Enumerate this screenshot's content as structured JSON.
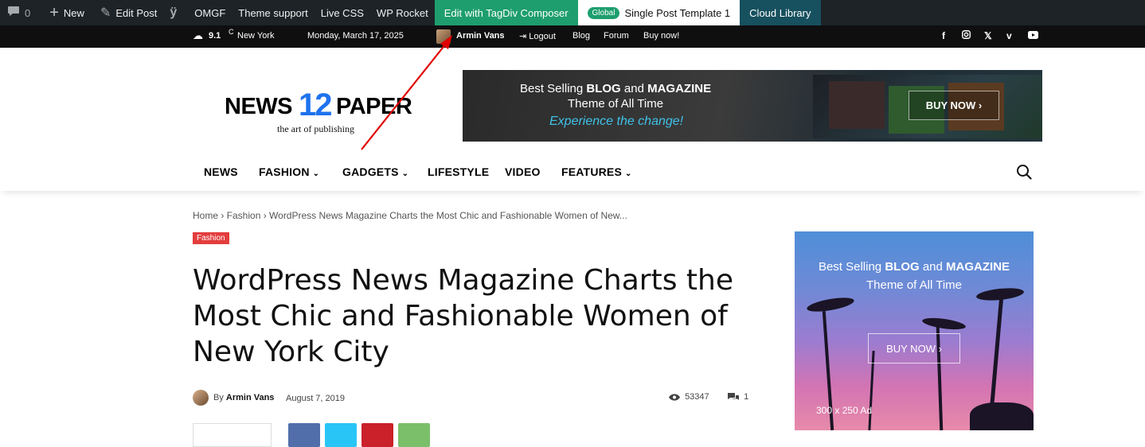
{
  "admin_bar": {
    "comments_count": "0",
    "new_label": "New",
    "edit_post_label": "Edit Post",
    "omgf_label": "OMGF",
    "theme_support_label": "Theme support",
    "live_css_label": "Live CSS",
    "wp_rocket_label": "WP Rocket",
    "composer_label": "Edit with TagDiv Composer",
    "template_badge": "Global",
    "template_label": "Single Post Template 1",
    "cloud_library_label": "Cloud Library"
  },
  "top_bar": {
    "temperature": "9.1",
    "temp_unit": "C",
    "city": "New York",
    "date": "Monday, March 17, 2025",
    "user_name": "Armin Vans",
    "logout_label": "Logout",
    "blog_label": "Blog",
    "forum_label": "Forum",
    "buy_now_label": "Buy now!",
    "social_icons": [
      "facebook-icon",
      "instagram-icon",
      "x-icon",
      "vimeo-icon",
      "youtube-icon"
    ]
  },
  "header": {
    "logo_left": "NEWS",
    "logo_number": "12",
    "logo_right": "PAPER",
    "logo_tagline": "the art of publishing",
    "banner": {
      "line1_prefix": "Best Selling ",
      "line1_blog": "BLOG",
      "line1_and": " and ",
      "line1_magazine": "MAGAZINE",
      "line2": "Theme of All Time",
      "line3": "Experience the change!",
      "button": "BUY NOW ›"
    }
  },
  "nav": {
    "items": [
      {
        "label": "NEWS",
        "dropdown": false
      },
      {
        "label": "FASHION",
        "dropdown": true
      },
      {
        "label": "GADGETS",
        "dropdown": true
      },
      {
        "label": "LIFESTYLE",
        "dropdown": false
      },
      {
        "label": "VIDEO",
        "dropdown": false
      },
      {
        "label": "FEATURES",
        "dropdown": true
      }
    ]
  },
  "post": {
    "breadcrumb": "Home › Fashion › WordPress News Magazine Charts the Most Chic and Fashionable Women of New...",
    "category": "Fashion",
    "title": "WordPress News Magazine Charts the Most Chic and Fashionable Women of New York City",
    "by_label": "By",
    "author": "Armin Vans",
    "date": "August 7, 2019",
    "views": "53347",
    "comments": "1"
  },
  "sidebar_ad": {
    "line1_prefix": "Best Selling ",
    "line1_blog": "BLOG",
    "line1_and": " and ",
    "line1_magazine": "MAGAZINE",
    "line2": "Theme of All Time",
    "button": "BUY NOW ›",
    "size_label": "300 x 250 Ad"
  },
  "colors": {
    "admin_bar_bg": "#1d2327",
    "composer_green": "#1e9e6f",
    "cloud_teal": "#17505e",
    "category_red": "#e33d3d",
    "logo_blue": "#1e73ee",
    "annotation_arrow": "#e00000"
  }
}
